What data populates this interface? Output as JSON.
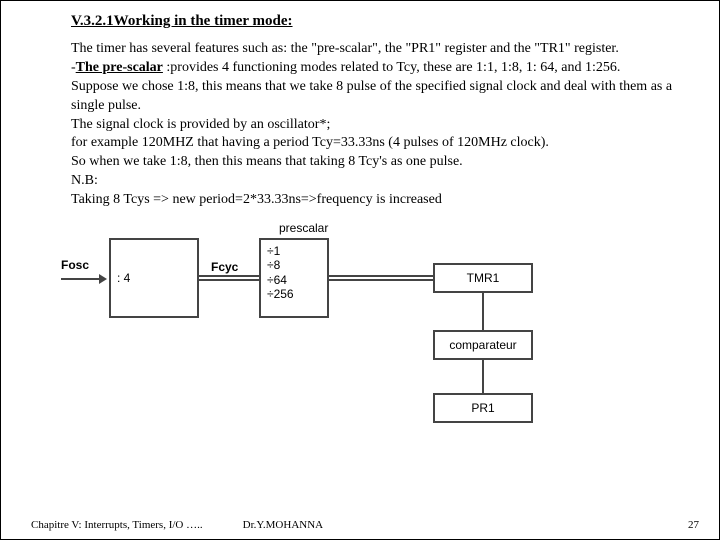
{
  "title": "V.3.2.1Working in the timer mode:",
  "para": {
    "l1": "The timer has several features such as: the \"pre-scalar\", the \"PR1\" register and the \"TR1\" register.",
    "l2a": "-",
    "l2b": "The pre-scalar",
    "l2c": " :provides 4 functioning modes related to Tcy, these are 1:1, 1:8, 1: 64, and 1:256.",
    "l3": "Suppose we chose 1:8, this means that we take 8 pulse of the specified signal clock and deal with them as a single pulse.",
    "l4": "The signal clock is provided by an oscillator*;",
    "l5": " for example 120MHZ that having a period Tcy=33.33ns (4 pulses of 120MHz clock).",
    "l6": "So when we take 1:8, then this means that taking 8 Tcy's as one pulse.",
    "l7": "N.B:",
    "l8": "Taking 8 Tcys => new period=2*33.33ns=>frequency is increased"
  },
  "diagram": {
    "fosc": "Fosc",
    "div4": ": 4",
    "fcyc": "Fcyc",
    "prescalar": "prescalar",
    "opt1": "÷1",
    "opt2": "÷8",
    "opt3": "÷64",
    "opt4": "÷256",
    "tmr1": "TMR1",
    "comparateur": "comparateur",
    "pr1": "PR1"
  },
  "footer": {
    "left": "Chapitre V: Interrupts, Timers, I/O …..",
    "mid": "Dr.Y.MOHANNA",
    "page": "27"
  }
}
